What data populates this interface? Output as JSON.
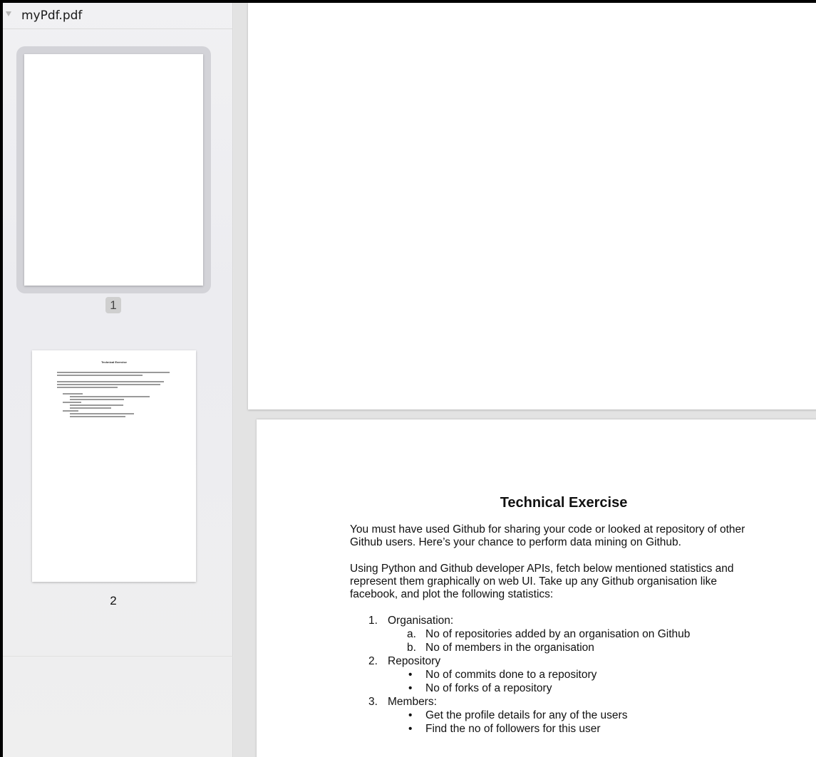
{
  "sidebar": {
    "file_name": "myPdf.pdf",
    "thumbnails": [
      {
        "page_number": "1",
        "selected": true
      },
      {
        "page_number": "2",
        "selected": false
      }
    ]
  },
  "document": {
    "title": "Technical Exercise",
    "para1_line1": "You must have used Github for sharing your code or looked at repository of other",
    "para1_line2": "Github users. Here’s your chance to perform data mining on Github.",
    "para2_line1": "Using Python and Github developer APIs, fetch below mentioned statistics and",
    "para2_line2": "represent them graphically on web UI. Take up any Github organisation like",
    "para2_line3": "facebook, and plot the following statistics:",
    "list": [
      {
        "marker": "1.",
        "label": "Organisation:",
        "sub": [
          {
            "marker": "a.",
            "label": "No of repositories added by an organisation on Github"
          },
          {
            "marker": "b.",
            "label": "No of members in the organisation"
          }
        ]
      },
      {
        "marker": "2.",
        "label": "Repository",
        "sub": [
          {
            "marker": "•",
            "label": "No of commits done to a repository"
          },
          {
            "marker": "•",
            "label": "No of forks of a repository"
          }
        ]
      },
      {
        "marker": "3.",
        "label": "Members:",
        "sub": [
          {
            "marker": "•",
            "label": "Get the profile details for any of the users"
          },
          {
            "marker": "•",
            "label": "Find the no of followers for this user"
          }
        ]
      }
    ]
  }
}
